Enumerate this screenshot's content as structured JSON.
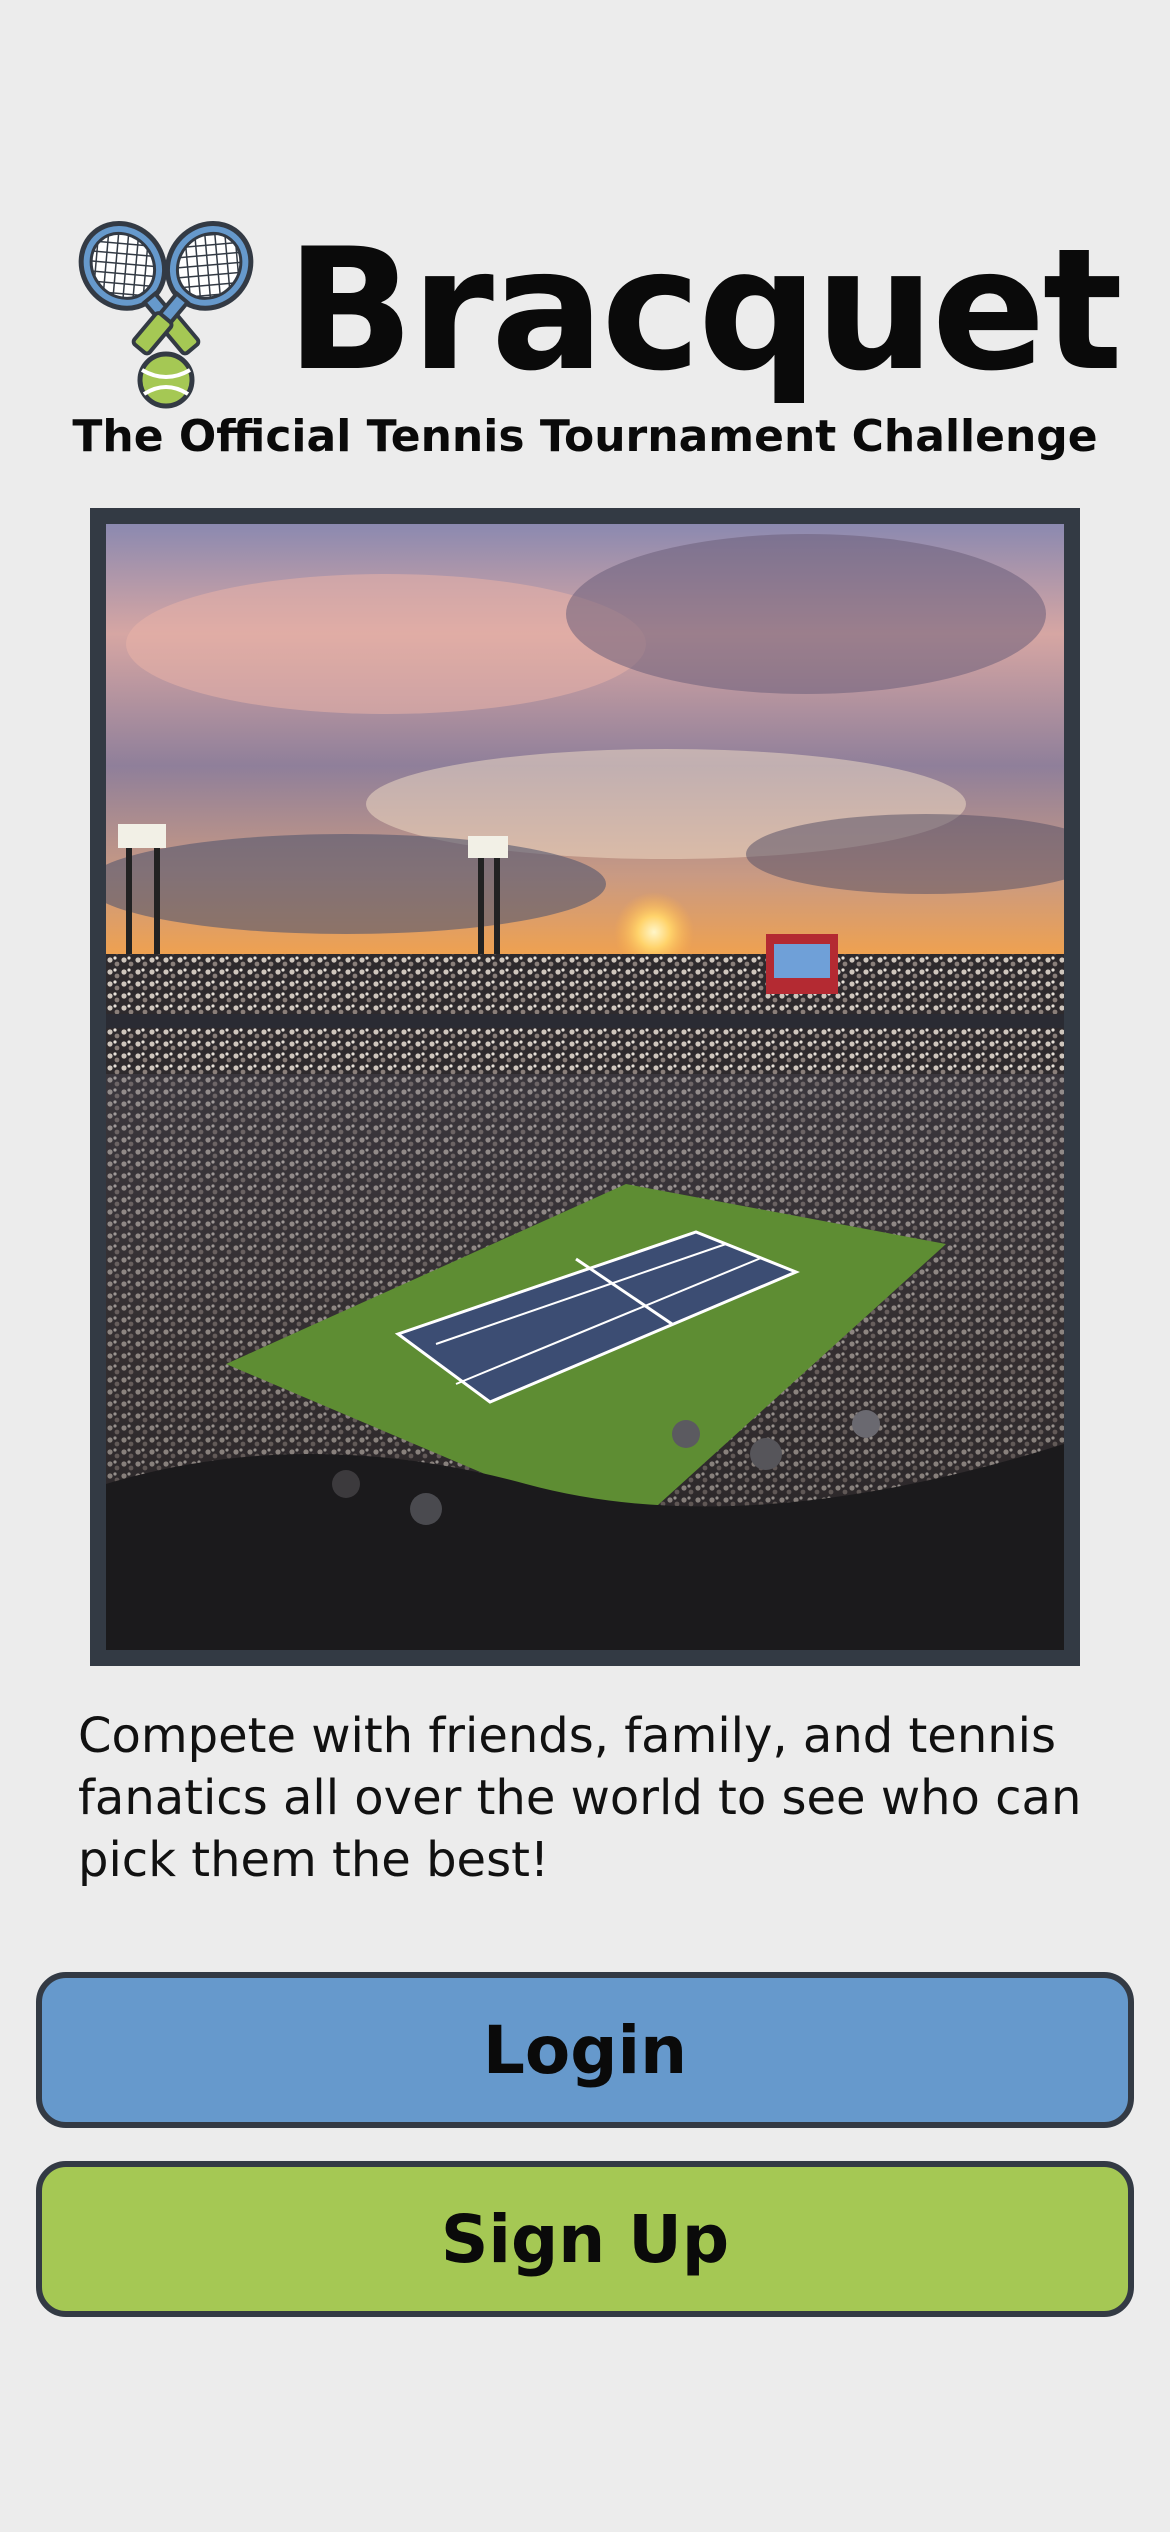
{
  "app": {
    "title": "Bracquet",
    "tagline": "The Official Tennis Tournament Challenge",
    "logo_icon": "crossed-rackets-icon"
  },
  "hero": {
    "subject": "tennis-stadium-photo"
  },
  "main": {
    "description": "Compete with friends, family, and tennis fanatics all over the world to see who can pick them the best!"
  },
  "actions": {
    "login_label": "Login",
    "signup_label": "Sign Up"
  },
  "colors": {
    "background": "#ececec",
    "login_button": "#6699cc",
    "signup_button": "#a5c854",
    "frame": "#333a44"
  }
}
